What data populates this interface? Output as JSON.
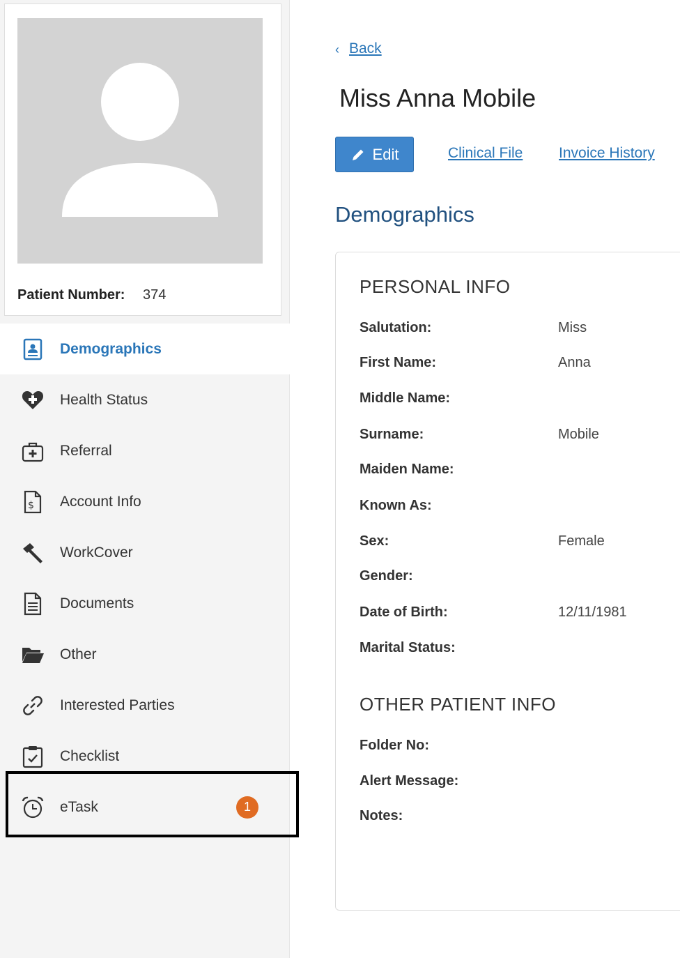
{
  "profile": {
    "patient_number_label": "Patient Number:",
    "patient_number": "374"
  },
  "sidebar": {
    "items": [
      {
        "label": "Demographics",
        "icon": "demographics-icon",
        "active": true
      },
      {
        "label": "Health Status",
        "icon": "heart-plus-icon"
      },
      {
        "label": "Referral",
        "icon": "medical-bag-icon"
      },
      {
        "label": "Account Info",
        "icon": "dollar-file-icon"
      },
      {
        "label": "WorkCover",
        "icon": "hammer-icon"
      },
      {
        "label": "Documents",
        "icon": "document-icon"
      },
      {
        "label": "Other",
        "icon": "folder-open-icon"
      },
      {
        "label": "Interested Parties",
        "icon": "link-icon"
      },
      {
        "label": "Checklist",
        "icon": "clipboard-check-icon"
      },
      {
        "label": "eTask",
        "icon": "alarm-clock-icon",
        "badge": "1"
      }
    ]
  },
  "header": {
    "back_label": "Back",
    "patient_name": "Miss Anna Mobile",
    "edit_label": "Edit",
    "clinical_file_label": "Clinical File",
    "invoice_history_label": "Invoice History"
  },
  "main": {
    "section_title": "Demographics",
    "personal_info": {
      "heading": "PERSONAL INFO",
      "fields": [
        {
          "label": "Salutation:",
          "value": "Miss"
        },
        {
          "label": "First Name:",
          "value": "Anna"
        },
        {
          "label": "Middle Name:",
          "value": ""
        },
        {
          "label": "Surname:",
          "value": "Mobile"
        },
        {
          "label": "Maiden Name:",
          "value": ""
        },
        {
          "label": "Known As:",
          "value": ""
        },
        {
          "label": "Sex:",
          "value": "Female"
        },
        {
          "label": "Gender:",
          "value": ""
        },
        {
          "label": "Date of Birth:",
          "value": "12/11/1981"
        },
        {
          "label": "Marital Status:",
          "value": ""
        }
      ]
    },
    "other_info": {
      "heading": "OTHER PATIENT INFO",
      "fields": [
        {
          "label": "Folder No:",
          "value": ""
        },
        {
          "label": "Alert Message:",
          "value": ""
        },
        {
          "label": "Notes:",
          "value": ""
        }
      ]
    }
  },
  "colors": {
    "accent": "#2a76b8",
    "section_title": "#20507f",
    "edit_button": "#3f86cc",
    "badge": "#e06b22",
    "sidebar_bg": "#f4f4f4"
  }
}
